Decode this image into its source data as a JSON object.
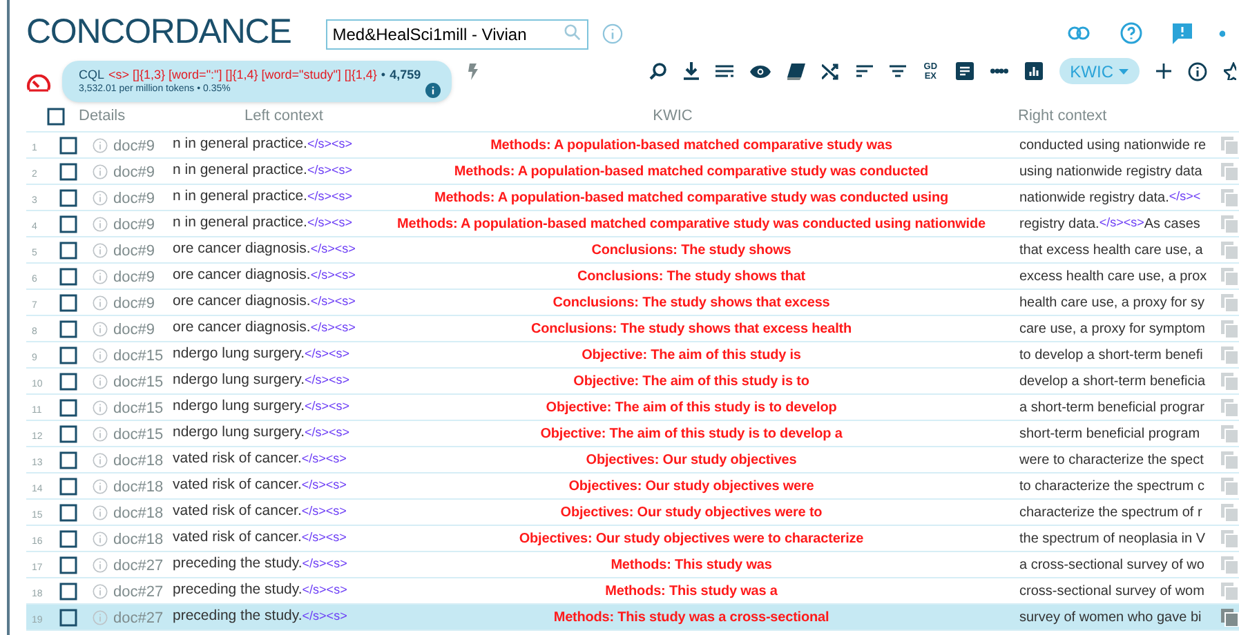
{
  "header": {
    "title": "CONCORDANCE",
    "corpus_search": {
      "value": "Med&HealSci1mill - Vivian"
    }
  },
  "query": {
    "label": "CQL",
    "expression": "<s> []{1,3} [word=\":\"] []{1,4} [word=\"study\"] []{1,4}",
    "separator": "•",
    "count": "4,759",
    "stats": "3,532.01 per million tokens • 0.35%"
  },
  "toolbar": {
    "gdex_text": "GD EX",
    "view_menu": "KWIC"
  },
  "columns": {
    "select_all_checked": false,
    "details": "Details",
    "left": "Left context",
    "kwic": "KWIC",
    "right": "Right context"
  },
  "rows": [
    {
      "num": "1",
      "doc": "doc#9",
      "left": "n in general practice.",
      "left_tag": "</s><s>",
      "kwic": "Methods: A population-based matched comparative study was",
      "right": [
        {
          "kind": "text",
          "text": "conducted using nationwide re"
        }
      ],
      "checked": false,
      "selected": false
    },
    {
      "num": "2",
      "doc": "doc#9",
      "left": "n in general practice.",
      "left_tag": "</s><s>",
      "kwic": "Methods: A population-based matched comparative study was conducted",
      "right": [
        {
          "kind": "text",
          "text": "using nationwide registry data"
        }
      ],
      "checked": false,
      "selected": false
    },
    {
      "num": "3",
      "doc": "doc#9",
      "left": "n in general practice.",
      "left_tag": "</s><s>",
      "kwic": "Methods: A population-based matched comparative study was conducted using",
      "right": [
        {
          "kind": "text",
          "text": "nationwide registry data."
        },
        {
          "kind": "tag",
          "text": "</s><"
        }
      ],
      "checked": false,
      "selected": false
    },
    {
      "num": "4",
      "doc": "doc#9",
      "left": "n in general practice.",
      "left_tag": "</s><s>",
      "kwic": "Methods: A population-based matched comparative study was conducted using nationwide",
      "right": [
        {
          "kind": "text",
          "text": "registry data."
        },
        {
          "kind": "tag",
          "text": "</s><s>"
        },
        {
          "kind": "text",
          "text": "As cases"
        }
      ],
      "checked": false,
      "selected": false
    },
    {
      "num": "5",
      "doc": "doc#9",
      "left": "ore cancer diagnosis.",
      "left_tag": "</s><s>",
      "kwic": "Conclusions: The study shows",
      "right": [
        {
          "kind": "text",
          "text": "that excess health care use, a"
        }
      ],
      "checked": false,
      "selected": false
    },
    {
      "num": "6",
      "doc": "doc#9",
      "left": "ore cancer diagnosis.",
      "left_tag": "</s><s>",
      "kwic": "Conclusions: The study shows that",
      "right": [
        {
          "kind": "text",
          "text": "excess health care use, a prox"
        }
      ],
      "checked": false,
      "selected": false
    },
    {
      "num": "7",
      "doc": "doc#9",
      "left": "ore cancer diagnosis.",
      "left_tag": "</s><s>",
      "kwic": "Conclusions: The study shows that excess",
      "right": [
        {
          "kind": "text",
          "text": "health care use, a proxy for sy"
        }
      ],
      "checked": false,
      "selected": false
    },
    {
      "num": "8",
      "doc": "doc#9",
      "left": "ore cancer diagnosis.",
      "left_tag": "</s><s>",
      "kwic": "Conclusions: The study shows that excess health",
      "right": [
        {
          "kind": "text",
          "text": "care use, a proxy for symptom"
        }
      ],
      "checked": false,
      "selected": false
    },
    {
      "num": "9",
      "doc": "doc#15",
      "left": "ndergo lung surgery.",
      "left_tag": "</s><s>",
      "kwic": "Objective: The aim of this study is",
      "right": [
        {
          "kind": "text",
          "text": "to develop a short-term benefi"
        }
      ],
      "checked": false,
      "selected": false
    },
    {
      "num": "10",
      "doc": "doc#15",
      "left": "ndergo lung surgery.",
      "left_tag": "</s><s>",
      "kwic": "Objective: The aim of this study is to",
      "right": [
        {
          "kind": "text",
          "text": "develop a short-term beneficia"
        }
      ],
      "checked": false,
      "selected": false
    },
    {
      "num": "11",
      "doc": "doc#15",
      "left": "ndergo lung surgery.",
      "left_tag": "</s><s>",
      "kwic": "Objective: The aim of this study is to develop",
      "right": [
        {
          "kind": "text",
          "text": "a short-term beneficial prograr"
        }
      ],
      "checked": false,
      "selected": false
    },
    {
      "num": "12",
      "doc": "doc#15",
      "left": "ndergo lung surgery.",
      "left_tag": "</s><s>",
      "kwic": "Objective: The aim of this study is to develop a",
      "right": [
        {
          "kind": "text",
          "text": "short-term beneficial program"
        }
      ],
      "checked": false,
      "selected": false
    },
    {
      "num": "13",
      "doc": "doc#18",
      "left": "vated risk of cancer.",
      "left_tag": "</s><s>",
      "kwic": "Objectives: Our study objectives",
      "right": [
        {
          "kind": "text",
          "text": "were to characterize the spect"
        }
      ],
      "checked": false,
      "selected": false
    },
    {
      "num": "14",
      "doc": "doc#18",
      "left": "vated risk of cancer.",
      "left_tag": "</s><s>",
      "kwic": "Objectives: Our study objectives were",
      "right": [
        {
          "kind": "text",
          "text": "to characterize the spectrum c"
        }
      ],
      "checked": false,
      "selected": false
    },
    {
      "num": "15",
      "doc": "doc#18",
      "left": "vated risk of cancer.",
      "left_tag": "</s><s>",
      "kwic": "Objectives: Our study objectives were to",
      "right": [
        {
          "kind": "text",
          "text": "characterize the spectrum of r"
        }
      ],
      "checked": false,
      "selected": false
    },
    {
      "num": "16",
      "doc": "doc#18",
      "left": "vated risk of cancer.",
      "left_tag": "</s><s>",
      "kwic": "Objectives: Our study objectives were to characterize",
      "right": [
        {
          "kind": "text",
          "text": "the spectrum of neoplasia in V"
        }
      ],
      "checked": false,
      "selected": false
    },
    {
      "num": "17",
      "doc": "doc#27",
      "left": "preceding the study.",
      "left_tag": "</s><s>",
      "kwic": "Methods: This study was",
      "right": [
        {
          "kind": "text",
          "text": "a cross-sectional survey of wo"
        }
      ],
      "checked": false,
      "selected": false
    },
    {
      "num": "18",
      "doc": "doc#27",
      "left": "preceding the study.",
      "left_tag": "</s><s>",
      "kwic": "Methods: This study was a",
      "right": [
        {
          "kind": "text",
          "text": "cross-sectional survey of wom"
        }
      ],
      "checked": false,
      "selected": false
    },
    {
      "num": "19",
      "doc": "doc#27",
      "left": "preceding the study.",
      "left_tag": "</s><s>",
      "kwic": "Methods: This study was a cross-sectional",
      "right": [
        {
          "kind": "text",
          "text": "survey of women who gave bi"
        }
      ],
      "checked": false,
      "selected": true
    }
  ]
}
